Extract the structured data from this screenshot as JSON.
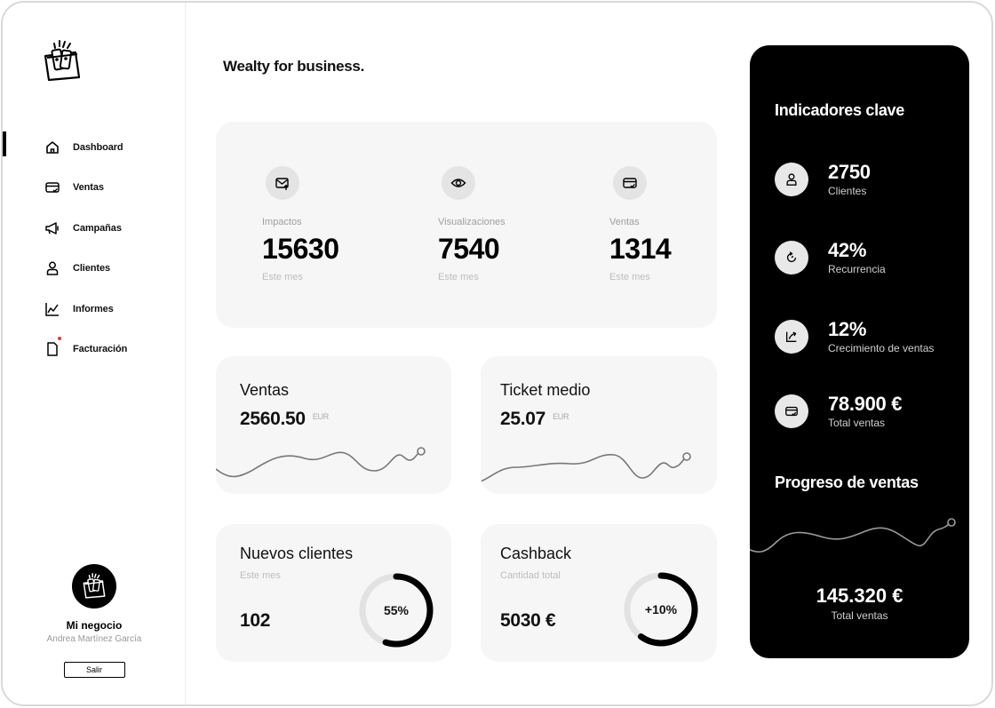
{
  "app": {
    "brand": "Wealty for business."
  },
  "sidebar": {
    "items": [
      {
        "label": "Dashboard",
        "icon": "home-icon",
        "active": true
      },
      {
        "label": "Ventas",
        "icon": "card-check-icon"
      },
      {
        "label": "Campañas",
        "icon": "megaphone-icon"
      },
      {
        "label": "Clientes",
        "icon": "user-icon"
      },
      {
        "label": "Informes",
        "icon": "chart-line-icon"
      },
      {
        "label": "Facturación",
        "icon": "document-icon",
        "notification": true
      }
    ],
    "profile": {
      "business": "Mi negocio",
      "user": "Andrea Martínez García",
      "logout_label": "Salir"
    }
  },
  "stats": [
    {
      "label": "Impactos",
      "value": "15630",
      "sub": "Este mes",
      "icon": "mail-up-icon"
    },
    {
      "label": "Visualizaciones",
      "value": "7540",
      "sub": "Este mes",
      "icon": "eye-icon"
    },
    {
      "label": "Ventas",
      "value": "1314",
      "sub": "Este mes",
      "icon": "card-check-icon"
    }
  ],
  "cards": {
    "ventas": {
      "title": "Ventas",
      "value": "2560.50",
      "unit": "EUR"
    },
    "ticket": {
      "title": "Ticket medio",
      "value": "25.07",
      "unit": "EUR"
    },
    "nuevos": {
      "title": "Nuevos clientes",
      "sub": "Este mes",
      "value": "102",
      "donut_label": "55%",
      "donut_percent": 55
    },
    "cashback": {
      "title": "Cashback",
      "sub": "Cantidad total",
      "value": "5030 €",
      "donut_label": "+10%",
      "donut_percent": 60
    }
  },
  "kpi": {
    "title": "Indicadores clave",
    "items": [
      {
        "value": "2750",
        "label": "Clientes",
        "icon": "user-icon"
      },
      {
        "value": "42%",
        "label": "Recurrencia",
        "icon": "refresh-icon"
      },
      {
        "value": "12%",
        "label": "Crecimiento de ventas",
        "icon": "growth-arrow-icon"
      },
      {
        "value": "78.900 €",
        "label": "Total ventas",
        "icon": "card-check-icon"
      }
    ],
    "progress_title": "Progreso de ventas",
    "total_value": "145.320 €",
    "total_label": "Total ventas"
  },
  "colors": {
    "accent": "#000000",
    "card_bg": "#f6f6f6",
    "notification": "#e53935"
  }
}
